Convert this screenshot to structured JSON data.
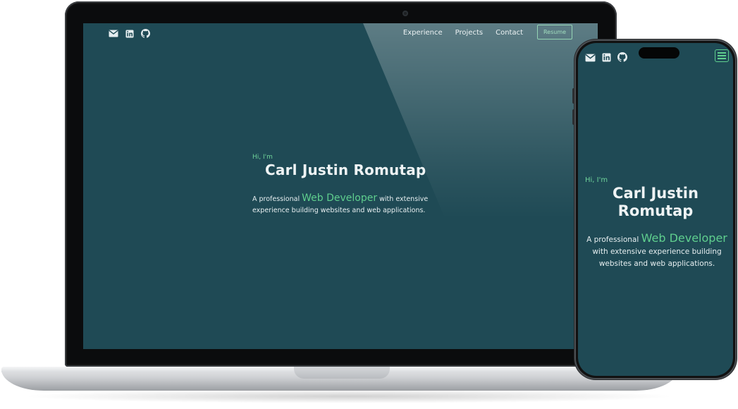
{
  "site": {
    "nav": {
      "links": [
        "Experience",
        "Projects",
        "Contact"
      ],
      "resume_label": "Resume",
      "icons": [
        "mail-icon",
        "linkedin-icon",
        "github-icon"
      ]
    },
    "hero": {
      "greeting": "Hi, I'm",
      "name": "Carl Justin Romutap",
      "desc_prefix": "A professional",
      "role": "Web Developer",
      "desc_suffix": "with extensive experience building websites and web applications."
    }
  },
  "mobile": {
    "name_line1": "Carl Justin",
    "name_line2": "Romutap",
    "menu_icon": "hamburger-menu-icon"
  },
  "colors": {
    "background": "#1f4a55",
    "accent": "#5fcf8e",
    "text": "#eef3f4"
  }
}
